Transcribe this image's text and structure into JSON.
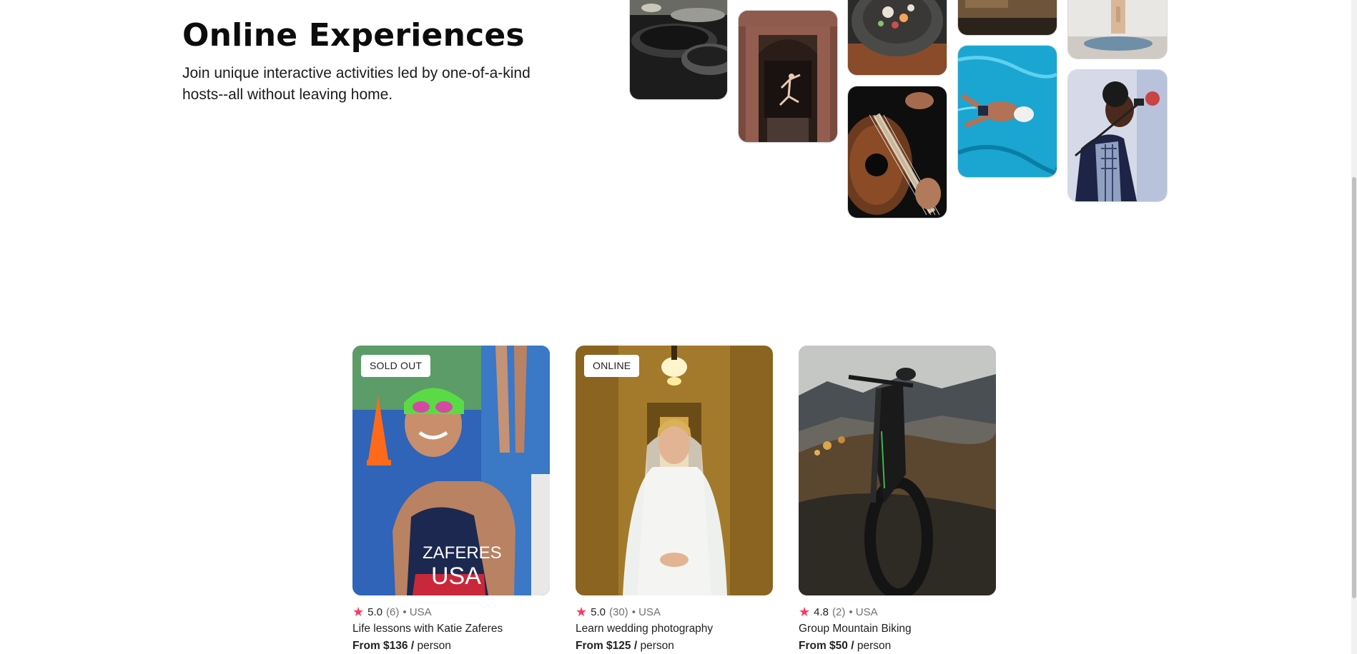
{
  "hero": {
    "title": "Online Experiences",
    "subtitle": "Join unique interactive activities led by one-of-a-kind hosts--all without leaving home."
  },
  "collage": [
    {
      "name": "cooking-pans-photo"
    },
    {
      "name": "dancer-doorway-photo"
    },
    {
      "name": "food-bowl-photo"
    },
    {
      "name": "guitar-photo"
    },
    {
      "name": "table-photo"
    },
    {
      "name": "swimmer-photo"
    },
    {
      "name": "yoga-photo"
    },
    {
      "name": "singer-photo"
    }
  ],
  "cards": [
    {
      "badge": "SOLD OUT",
      "rating": "5.0",
      "reviews": "(6)",
      "location": "• USA",
      "title": "Life lessons with Katie Zaferes",
      "price_bold": "From $136 /",
      "price_unit": "person"
    },
    {
      "badge": "ONLINE",
      "rating": "5.0",
      "reviews": "(30)",
      "location": "• USA",
      "title": "Learn wedding photography",
      "price_bold": "From $125 /",
      "price_unit": "person"
    },
    {
      "badge": "",
      "rating": "4.8",
      "reviews": "(2)",
      "location": "• USA",
      "title": "Group Mountain Biking",
      "price_bold": "From $50 /",
      "price_unit": "person"
    }
  ],
  "icons": {
    "star": "star-icon"
  },
  "colors": {
    "star": "#ff385c",
    "text": "#222222",
    "muted": "#717171"
  }
}
